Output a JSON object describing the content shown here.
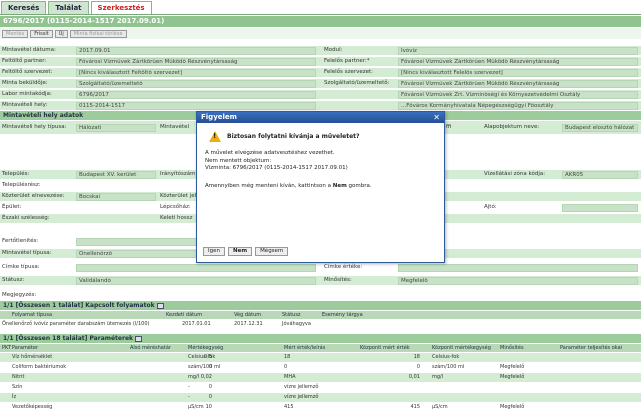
{
  "tabs": [
    "Keresés",
    "Találat",
    "Szerkesztés"
  ],
  "title": "6796/2017 (0115-2014-1517 2017.09.01)",
  "toolbar": [
    "Mentés",
    "Frissít",
    "Új",
    "Minta fizikai törlése"
  ],
  "fields": {
    "r1l": "Mintavétel dátuma:",
    "r1v": "2017.09.01",
    "r1l2": "Modul:",
    "r1v2": "Ivóvíz",
    "r2l": "Feltöltő partner:",
    "r2v": "Fővárosi Vízművek Zártkörűen Működő Részvénytársaság",
    "r2l2": "Felelős partner:*",
    "r2v2": "Fővárosi Vízművek Zártkörűen Működő Részvénytársaság",
    "r3l": "Feltöltő szervezet:",
    "r3v": "[Nincs kiválasztott Feltöltő szervezet]",
    "r3l2": "Felelős szervezet:",
    "r3v2": "[Nincs kiválasztott Felelős szervezet]",
    "r4l": "Minta beküldője:",
    "r4v": "Szolgáltató/üzemeltető",
    "r4l2": "Szolgáltató/üzemeltető:",
    "r4v2": "Fővárosi Vízművek Zártkörűen Működő Részvénytársaság",
    "r5l": "Labor mintakódja:",
    "r5v": "6796/2017",
    "r5v2": "Fővárosi Vízművek Zrt. Vízminőségi és Környezetvédelmi Osztály",
    "r6l": "Mintavételi hely:",
    "r6v": "0115-2014-1517",
    "r6v2": "...Főváros Kormányhivatala Népegészségügyi Főosztály"
  },
  "sect1": "Mintavételi hely adatok",
  "place": {
    "typeL": "Mintavételi hely típusa:",
    "typeV": "Hálózati",
    "mvL": "Mintavétel",
    "alapL": "Alapobjektum neve:",
    "alapV": "Budapest elosztó hálózat",
    "ffi": "ffi",
    "telL": "Település:",
    "telV": "Budapest XV. kerület",
    "irL": "Irányítószám",
    "vzL": "Vízellátási zóna kódja:",
    "vzV": "AKR05",
    "telrL": "Településrész:",
    "kozL": "Közterület elnevezése:",
    "kozV": "Bocskai",
    "kozjL": "Közterület jel",
    "epL": "Épület:",
    "lepL": "Lépcsőház:",
    "ajtoL": "Ajtó:",
    "eszL": "Északi szélesség:",
    "kelL": "Keleti hossz",
    "fertL": "Fertőtlenítés:",
    "mtL": "Mintavétel típusa:",
    "mtV": "Önellenőrző",
    "cimkeL": "Címke típusa:",
    "cimkeE": "Címke értéke:",
    "statL": "Státusz:",
    "statV": "Validálandó",
    "minL": "Minősítés:",
    "minV": "Megfelelő",
    "megL": "Megjegyzés:"
  },
  "kapcs": {
    "title": "1/1 [Összesen 1 találat]  Kapcsolt folyamatok",
    "head": [
      "Folyamat típusa",
      "Kezdeti dátum",
      "Vég dátum",
      "Státusz",
      "Esemény tárgya"
    ],
    "row": [
      "Önellenőrző ivóvíz paraméter darabszám ütemezés (I/100)",
      "2017.01.01",
      "2017.12.31",
      "Jóváhagyva",
      ""
    ]
  },
  "params": {
    "title": "1/1 [Összesen 18 találat]  Paraméterek",
    "head": [
      "PKT",
      "Paraméter",
      "Alsó méréshatár",
      "Mértékegység",
      "Mért érték/leírás",
      "Központi mért érték",
      "Központi mértékegység",
      "Minősítés",
      "Paraméter teljesítés okai"
    ],
    "rows": [
      [
        "",
        "Víz hőmérséklet",
        "0,5",
        "Celsius-fok",
        "18",
        "18",
        "Celsius-fok",
        "",
        ""
      ],
      [
        "",
        "Coliform baktériumok",
        "0",
        "szám/100 ml",
        "0",
        "0",
        "szám/100 ml",
        "Megfelelő",
        ""
      ],
      [
        "",
        "Nitrit",
        "0,02",
        "mg/l",
        "MHA",
        "0,01",
        "mg/l",
        "Megfelelő",
        ""
      ],
      [
        "",
        "Szín",
        "0",
        "-",
        "vízre jellemző",
        "",
        "",
        "",
        ""
      ],
      [
        "",
        "Íz",
        "0",
        "-",
        "vízre jellemző",
        "",
        "",
        "",
        ""
      ],
      [
        "",
        "Vezetőképesség",
        "10",
        "µS/cm",
        "415",
        "415",
        "µS/cm",
        "Megfelelő",
        ""
      ]
    ]
  },
  "dialog": {
    "title": "Figyelem",
    "question": "Biztosan folytatni kívánja a műveletet?",
    "l1": "A művelet elvégzése adatvesztéshez vezethet.",
    "l2": "Nem mentett objektum:",
    "l3": "Vízminta: 6796/2017 (0115-2014-1517 2017.09.01)",
    "l4a": "Amennyiben még menteni kíván, kattintson a ",
    "l4b": "Nem",
    "l4c": " gombra.",
    "yes": "Igen",
    "no": "Nem",
    "cancel": "Mégsem"
  }
}
